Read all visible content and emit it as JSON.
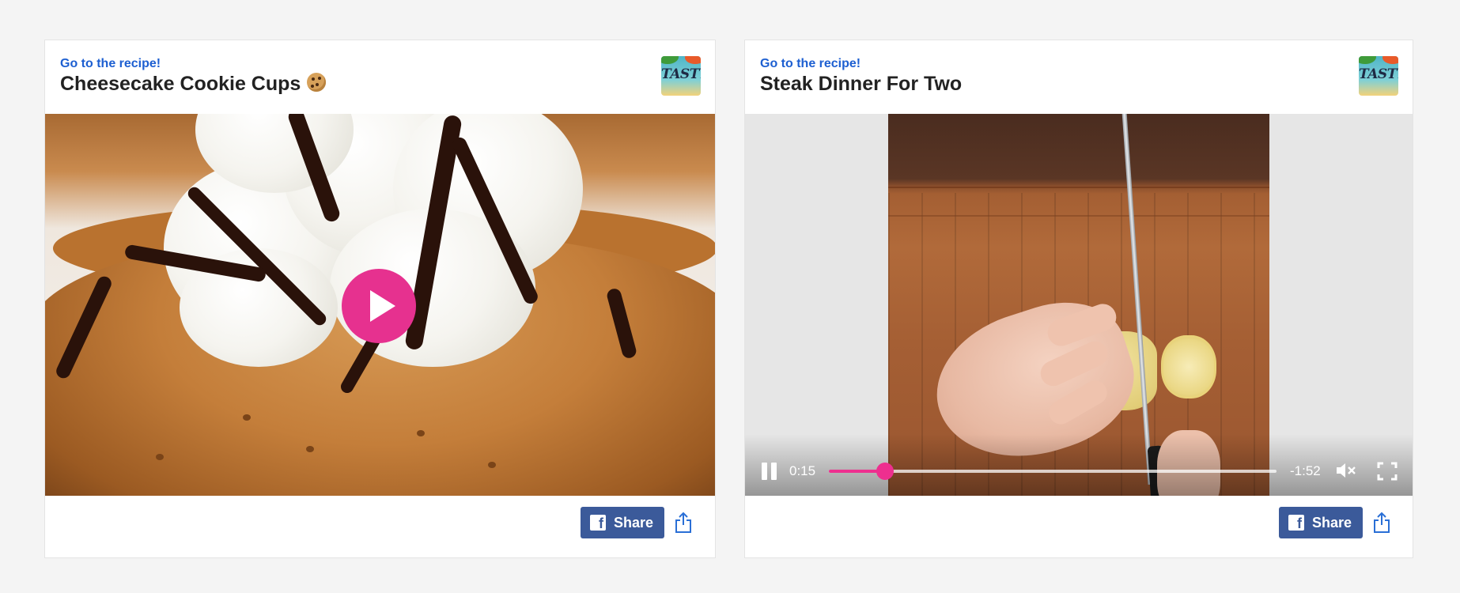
{
  "cards": [
    {
      "link_label": "Go to the recipe!",
      "title": "Cheesecake Cookie Cups",
      "title_emoji_icon": "cookie-icon",
      "logo_text": "TASTY",
      "media_state": "paused-with-play-button",
      "share_label": "Share"
    },
    {
      "link_label": "Go to the recipe!",
      "title": "Steak Dinner For Two",
      "logo_text": "TASTY",
      "media_state": "playing",
      "player": {
        "elapsed": "0:15",
        "remaining": "-1:52",
        "progress": 0.125,
        "muted": true
      },
      "share_label": "Share"
    }
  ],
  "colors": {
    "link": "#1d5fd1",
    "accent_pink": "#e6318f",
    "facebook_blue": "#3b5a9a",
    "page_bg": "#f4f4f4"
  }
}
